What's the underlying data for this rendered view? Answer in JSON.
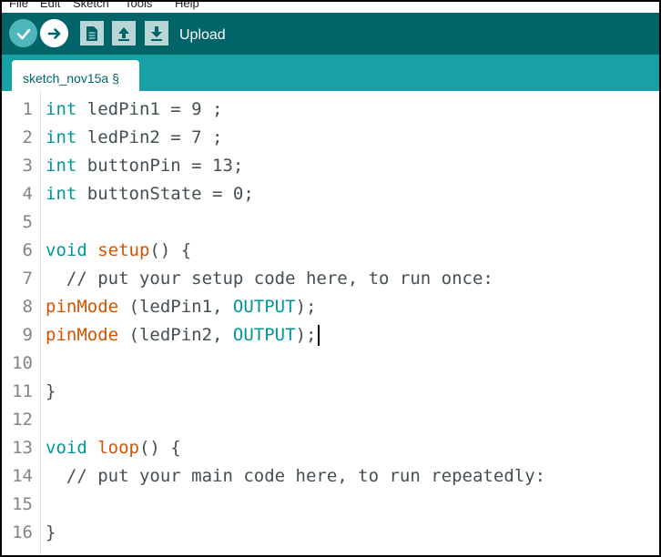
{
  "menu": [
    "File",
    "Edit",
    "Sketch",
    "Tools",
    "Help"
  ],
  "toolbar": {
    "upload_label": "Upload",
    "icons": [
      "verify-icon",
      "upload-arrow-icon",
      "new-icon",
      "open-icon",
      "save-icon"
    ]
  },
  "tab": {
    "label": "sketch_nov15a §"
  },
  "colors": {
    "toolbar": "#006468",
    "tabstrip": "#17a1a5",
    "keyword": "#00979c",
    "function": "#d35400",
    "text": "#434f54"
  },
  "editor": {
    "lines": [
      {
        "n": "1",
        "segments": [
          {
            "t": "int",
            "c": "k"
          },
          {
            "t": " ledPin1 = 9 ;",
            "c": "c"
          }
        ]
      },
      {
        "n": "2",
        "segments": [
          {
            "t": "int",
            "c": "k"
          },
          {
            "t": " ledPin2 = 7 ;",
            "c": "c"
          }
        ]
      },
      {
        "n": "3",
        "segments": [
          {
            "t": "int",
            "c": "k"
          },
          {
            "t": " buttonPin = 13;",
            "c": "c"
          }
        ]
      },
      {
        "n": "4",
        "segments": [
          {
            "t": "int",
            "c": "k"
          },
          {
            "t": " buttonState = 0;",
            "c": "c"
          }
        ]
      },
      {
        "n": "5",
        "segments": []
      },
      {
        "n": "6",
        "segments": [
          {
            "t": "void",
            "c": "k"
          },
          {
            "t": " ",
            "c": "c"
          },
          {
            "t": "setup",
            "c": "f"
          },
          {
            "t": "() {",
            "c": "c"
          }
        ]
      },
      {
        "n": "7",
        "segments": [
          {
            "t": "  // put your setup code here, to run once:",
            "c": "c"
          }
        ]
      },
      {
        "n": "8",
        "segments": [
          {
            "t": "pinMode",
            "c": "f"
          },
          {
            "t": " (ledPin1, ",
            "c": "c"
          },
          {
            "t": "OUTPUT",
            "c": "k"
          },
          {
            "t": ");",
            "c": "c"
          }
        ]
      },
      {
        "n": "9",
        "segments": [
          {
            "t": "pinMode",
            "c": "f"
          },
          {
            "t": " (ledPin2, ",
            "c": "c"
          },
          {
            "t": "OUTPUT",
            "c": "k"
          },
          {
            "t": ");",
            "c": "c"
          }
        ],
        "cursor": true
      },
      {
        "n": "10",
        "segments": []
      },
      {
        "n": "11",
        "segments": [
          {
            "t": "}",
            "c": "c"
          }
        ]
      },
      {
        "n": "12",
        "segments": []
      },
      {
        "n": "13",
        "segments": [
          {
            "t": "void",
            "c": "k"
          },
          {
            "t": " ",
            "c": "c"
          },
          {
            "t": "loop",
            "c": "f"
          },
          {
            "t": "() {",
            "c": "c"
          }
        ]
      },
      {
        "n": "14",
        "segments": [
          {
            "t": "  // put your main code here, to run repeatedly:",
            "c": "c"
          }
        ]
      },
      {
        "n": "15",
        "segments": []
      },
      {
        "n": "16",
        "segments": [
          {
            "t": "}",
            "c": "c"
          }
        ]
      }
    ]
  }
}
